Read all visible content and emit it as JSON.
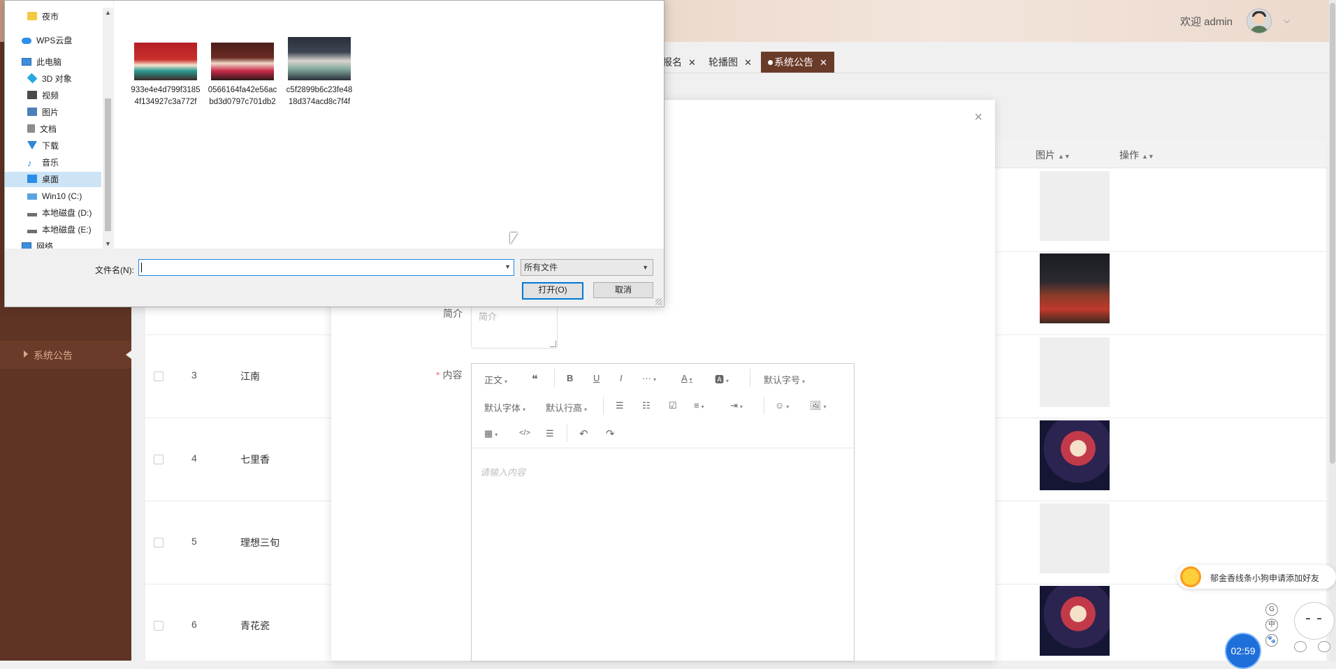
{
  "header": {
    "welcome": "欢迎 admin"
  },
  "sidebar": {
    "active_item": "系统公告"
  },
  "tabs": [
    {
      "label": "报名",
      "active": false
    },
    {
      "label": "轮播图",
      "active": false
    },
    {
      "label": "系统公告",
      "active": true
    }
  ],
  "table": {
    "columns": [
      "图片",
      "操作"
    ],
    "rows": [
      {
        "num": "",
        "name": "",
        "image": "blank"
      },
      {
        "num": "",
        "name": "",
        "image": "photo-stage"
      },
      {
        "num": "3",
        "name": "江南",
        "image": "blank"
      },
      {
        "num": "4",
        "name": "七里香",
        "image": "photo-opera"
      },
      {
        "num": "5",
        "name": "理想三旬",
        "image": "blank"
      },
      {
        "num": "6",
        "name": "青花瓷",
        "image": "photo-opera"
      }
    ]
  },
  "modal": {
    "close_icon": "×",
    "intro_label": "简介",
    "intro_placeholder": "简介",
    "content_label": "内容",
    "content_required_mark": "*",
    "editor": {
      "row1": [
        "正文",
        "❝",
        "B",
        "U",
        "I",
        "···",
        "A",
        "🅰",
        "默认字号"
      ],
      "row2": [
        "默认字体",
        "默认行高",
        "☰",
        "☷",
        "☑",
        "≡",
        "⇥",
        "☺",
        "🖼"
      ],
      "row3": [
        "▦",
        "</>",
        "☰",
        "↶",
        "↷"
      ],
      "placeholder": "请输入内容"
    }
  },
  "file_dialog": {
    "nav": [
      {
        "label": "夜市",
        "icon": "folder-icon"
      },
      {
        "label": "WPS云盘",
        "icon": "cloud-icon"
      },
      {
        "label": "此电脑",
        "icon": "computer-icon"
      },
      {
        "label": "3D 对象",
        "icon": "cube-icon"
      },
      {
        "label": "视频",
        "icon": "video-icon"
      },
      {
        "label": "图片",
        "icon": "picture-icon"
      },
      {
        "label": "文档",
        "icon": "document-icon"
      },
      {
        "label": "下载",
        "icon": "download-icon"
      },
      {
        "label": "音乐",
        "icon": "music-icon"
      },
      {
        "label": "桌面",
        "icon": "desktop-icon",
        "selected": true
      },
      {
        "label": "Win10 (C:)",
        "icon": "windows-drive-icon"
      },
      {
        "label": "本地磁盘 (D:)",
        "icon": "drive-icon"
      },
      {
        "label": "本地磁盘 (E:)",
        "icon": "drive-icon"
      },
      {
        "label": "网络",
        "icon": "network-icon"
      }
    ],
    "files": [
      {
        "name": "933e4e4d799f31854f134927c3a772f"
      },
      {
        "name": "0566164fa42e56acbd3d0797c701db2"
      },
      {
        "name": "c5f2899b6c23fe4818d374acd8c7f4f"
      }
    ],
    "filename_label": "文件名(N):",
    "filename_value": "",
    "filetype": "所有文件",
    "open_button": "打开(O)",
    "cancel_button": "取消"
  },
  "notification": {
    "text": "郁金香线条小狗申请添加好友",
    "close": "×"
  },
  "timer": {
    "value": "02:59"
  },
  "side_icons": [
    "G",
    "中",
    "🐾"
  ]
}
